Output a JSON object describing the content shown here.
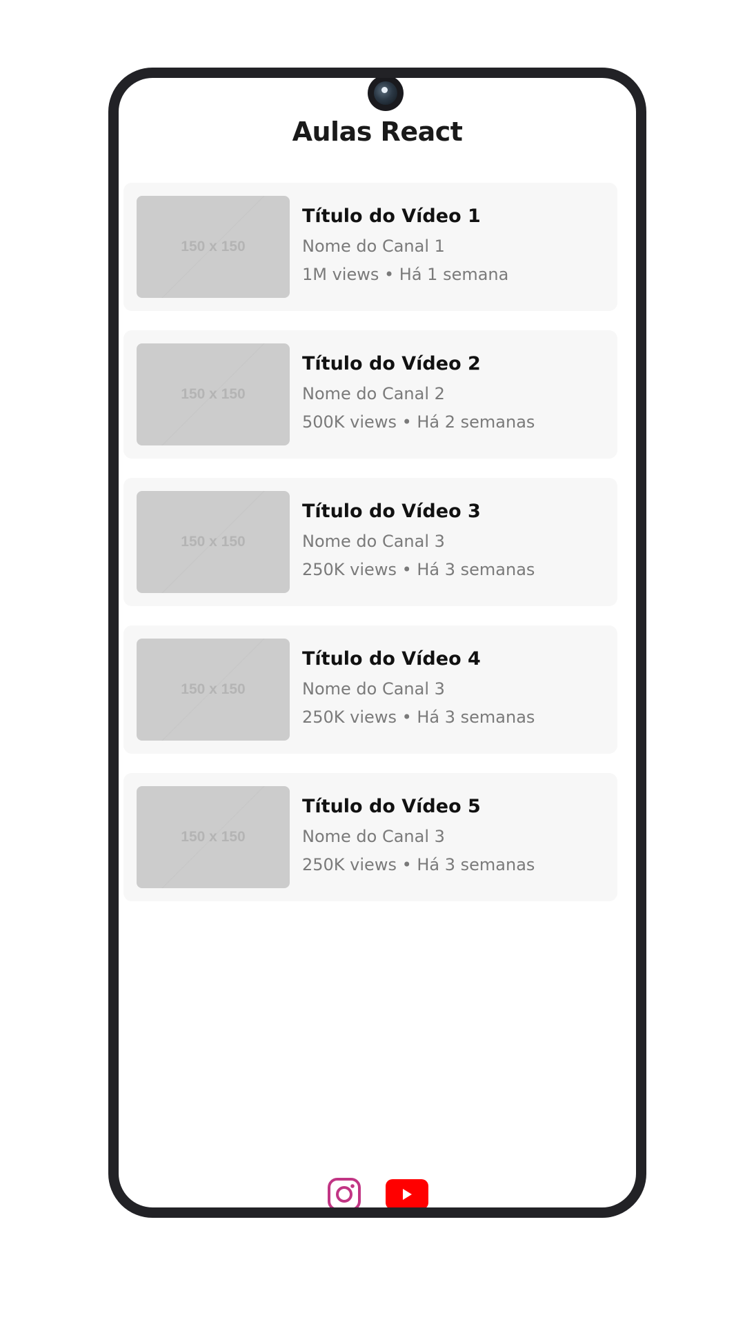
{
  "app": {
    "title": "Aulas React"
  },
  "videos": [
    {
      "thumbnail_label": "150 x 150",
      "title": "Título do Vídeo 1",
      "channel": "Nome do Canal 1",
      "meta": "1M views • Há 1 semana"
    },
    {
      "thumbnail_label": "150 x 150",
      "title": "Título do Vídeo 2",
      "channel": "Nome do Canal 2",
      "meta": "500K views • Há 2 semanas"
    },
    {
      "thumbnail_label": "150 x 150",
      "title": "Título do Vídeo 3",
      "channel": "Nome do Canal 3",
      "meta": "250K views • Há 3 semanas"
    },
    {
      "thumbnail_label": "150 x 150",
      "title": "Título do Vídeo 4",
      "channel": "Nome do Canal 3",
      "meta": "250K views • Há 3 semanas"
    },
    {
      "thumbnail_label": "150 x 150",
      "title": "Título do Vídeo 5",
      "channel": "Nome do Canal 3",
      "meta": "250K views • Há 3 semanas"
    }
  ],
  "footer": {
    "icons": [
      "instagram-icon",
      "youtube-icon"
    ]
  },
  "colors": {
    "card_background": "#f7f7f7",
    "thumbnail_placeholder": "#cccccc",
    "phone_frame": "#222226",
    "instagram": "#c13584",
    "youtube": "#ff0000"
  }
}
